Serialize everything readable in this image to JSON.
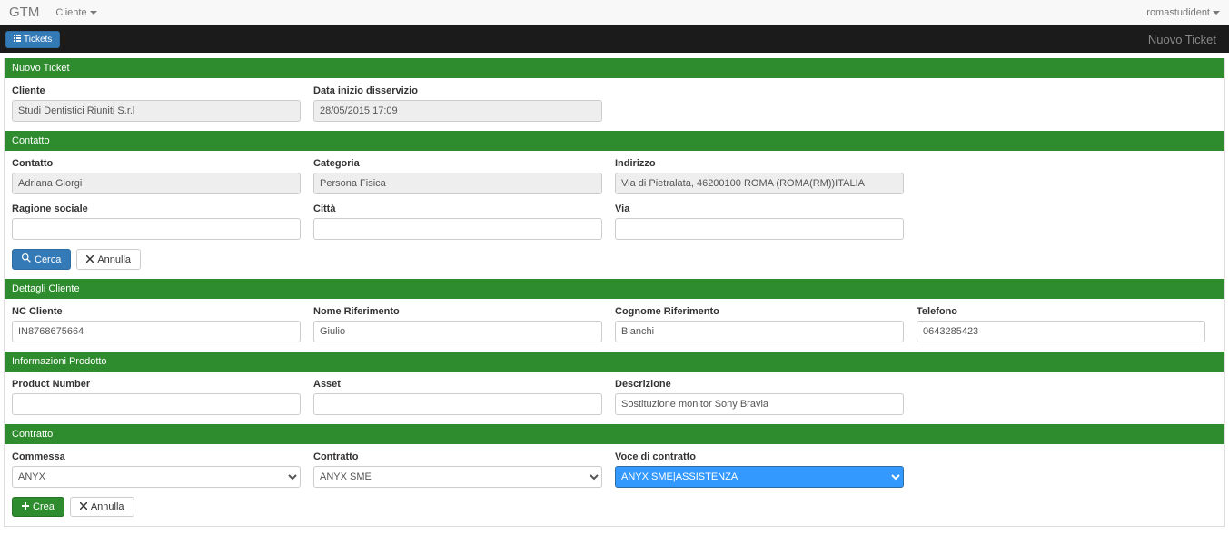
{
  "nav": {
    "brand": "GTM",
    "client_label": "Cliente",
    "user_label": "romastudident",
    "tickets_btn": "Tickets",
    "page_title": "Nuovo Ticket"
  },
  "panels": {
    "nuovo_ticket": "Nuovo Ticket",
    "contatto": "Contatto",
    "dettagli_cliente": "Dettagli Cliente",
    "info_prodotto": "Informazioni Prodotto",
    "contratto": "Contratto"
  },
  "nuovo": {
    "cliente_label": "Cliente",
    "cliente_value": "Studi Dentistici Riuniti S.r.l",
    "data_label": "Data inizio disservizio",
    "data_value": "28/05/2015 17:09"
  },
  "contatto": {
    "contatto_label": "Contatto",
    "contatto_value": "Adriana Giorgi",
    "categoria_label": "Categoria",
    "categoria_value": "Persona Fisica",
    "indirizzo_label": "Indirizzo",
    "indirizzo_value": "Via di Pietralata, 46200100 ROMA (ROMA(RM))ITALIA",
    "ragione_label": "Ragione sociale",
    "ragione_value": "",
    "citta_label": "Città",
    "citta_value": "",
    "via_label": "Via",
    "via_value": "",
    "cerca_btn": "Cerca",
    "annulla_btn": "Annulla"
  },
  "dettagli": {
    "nc_label": "NC Cliente",
    "nc_value": "IN8768675664",
    "nome_label": "Nome Riferimento",
    "nome_value": "Giulio",
    "cognome_label": "Cognome Riferimento",
    "cognome_value": "Bianchi",
    "telefono_label": "Telefono",
    "telefono_value": "0643285423"
  },
  "prodotto": {
    "pn_label": "Product Number",
    "pn_value": "",
    "asset_label": "Asset",
    "asset_value": "",
    "desc_label": "Descrizione",
    "desc_value": "Sostituzione monitor Sony Bravia"
  },
  "contratto": {
    "commessa_label": "Commessa",
    "commessa_value": "ANYX",
    "contratto_label": "Contratto",
    "contratto_value": "ANYX SME",
    "voce_label": "Voce di contratto",
    "voce_value": "ANYX SME|ASSISTENZA",
    "crea_btn": "Crea",
    "annulla_btn": "Annulla"
  }
}
